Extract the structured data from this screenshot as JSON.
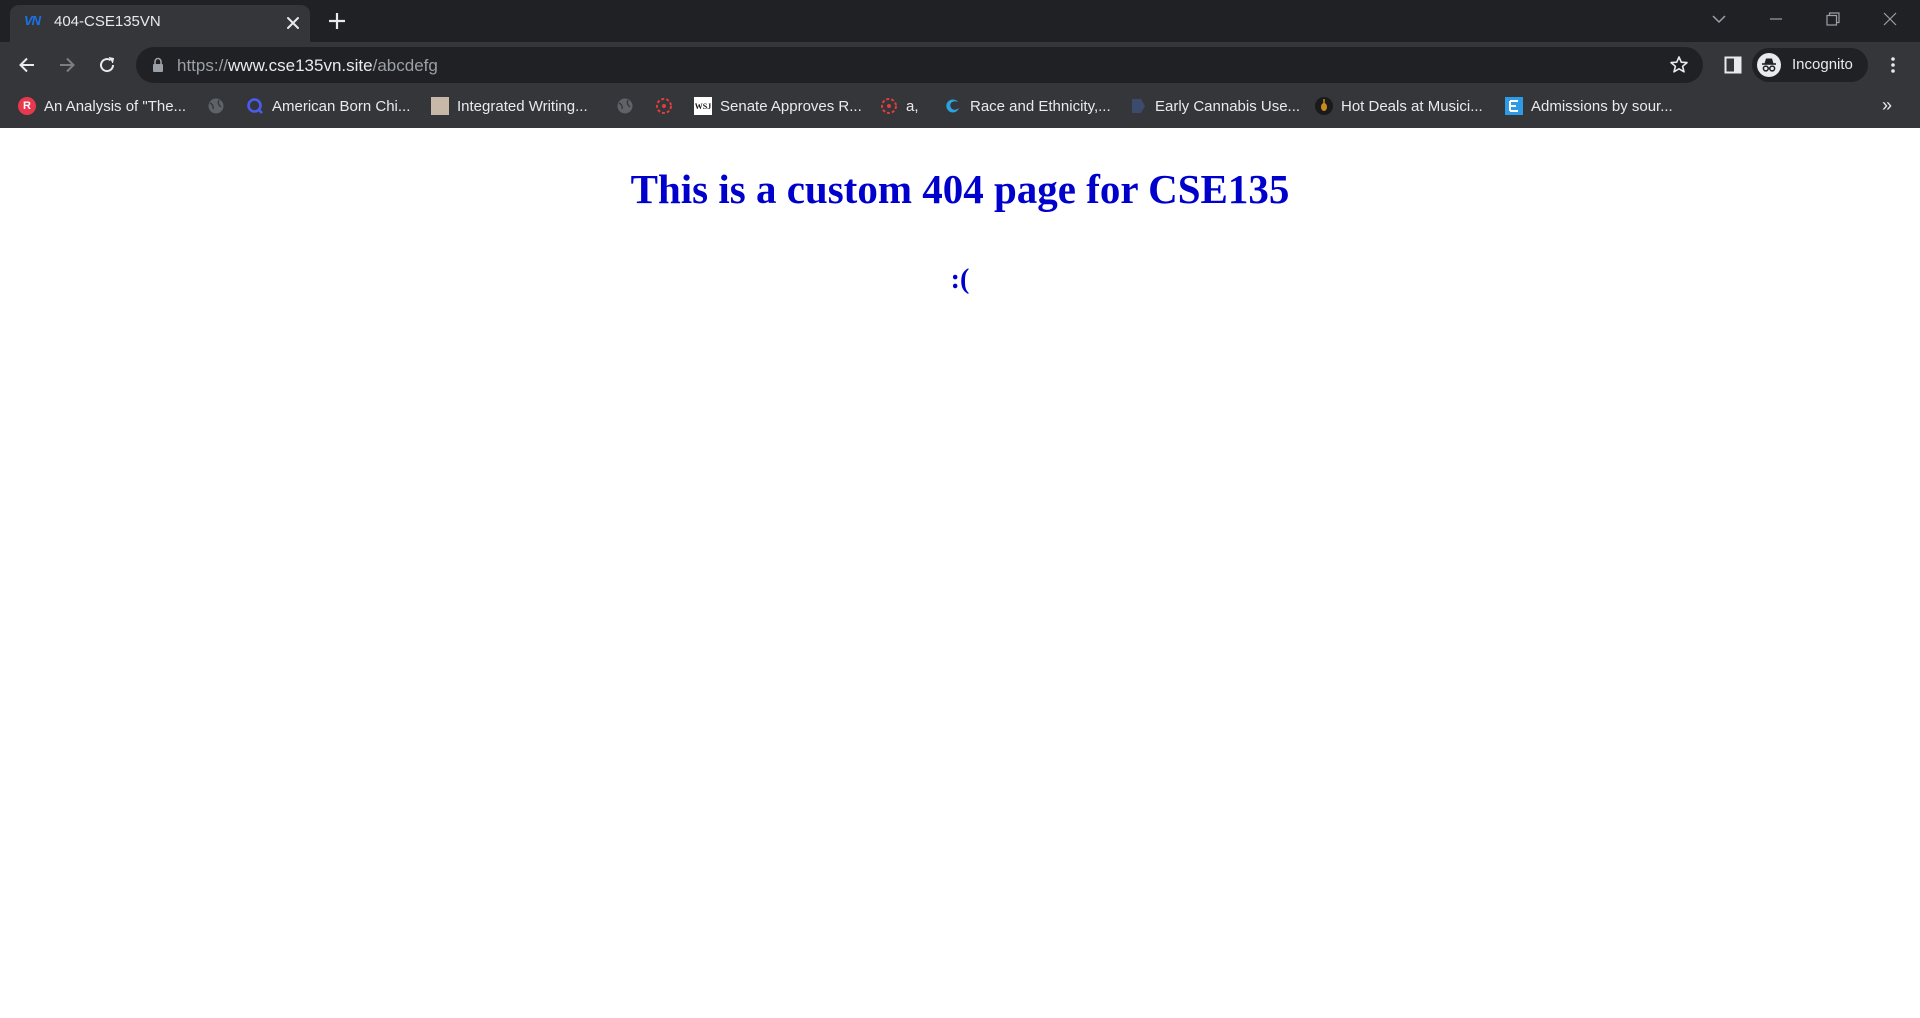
{
  "browser": {
    "tab": {
      "title": "404-CSE135VN",
      "favicon": "VN"
    },
    "url": {
      "scheme": "https://",
      "host": "www.cse135vn.site",
      "path": "/abcdefg"
    },
    "profile_label": "Incognito",
    "bookmarks": [
      {
        "label": "An Analysis of \"The...",
        "icon": "R",
        "color": "#e8384f"
      },
      {
        "label": "",
        "icon": "globe",
        "color": "#5f6368"
      },
      {
        "label": "American Born Chi...",
        "icon": "Q",
        "color": "#3b4cca"
      },
      {
        "label": "Integrated Writing...",
        "icon": "thumb",
        "color": "#c8b8a8"
      },
      {
        "label": "",
        "icon": "globe",
        "color": "#5f6368"
      },
      {
        "label": "",
        "icon": "canvas",
        "color": "#e23d3d"
      },
      {
        "label": "Senate Approves R...",
        "icon": "WSJ",
        "color": "#ffffff"
      },
      {
        "label": "a,",
        "icon": "canvas",
        "color": "#e23d3d"
      },
      {
        "label": "Race and Ethnicity,...",
        "icon": "edge",
        "color": "#2aa3e0"
      },
      {
        "label": "Early Cannabis Use...",
        "icon": "flag",
        "color": "#3c4a6b"
      },
      {
        "label": "Hot Deals at Musici...",
        "icon": "guitar",
        "color": "#1a1a1a"
      },
      {
        "label": "Admissions by sour...",
        "icon": "E",
        "color": "#2e9be6"
      }
    ],
    "overflow": "»"
  },
  "page": {
    "heading": "This is a custom 404 page for CSE135",
    "subtext": ":(",
    "text_color": "#0000cd"
  }
}
